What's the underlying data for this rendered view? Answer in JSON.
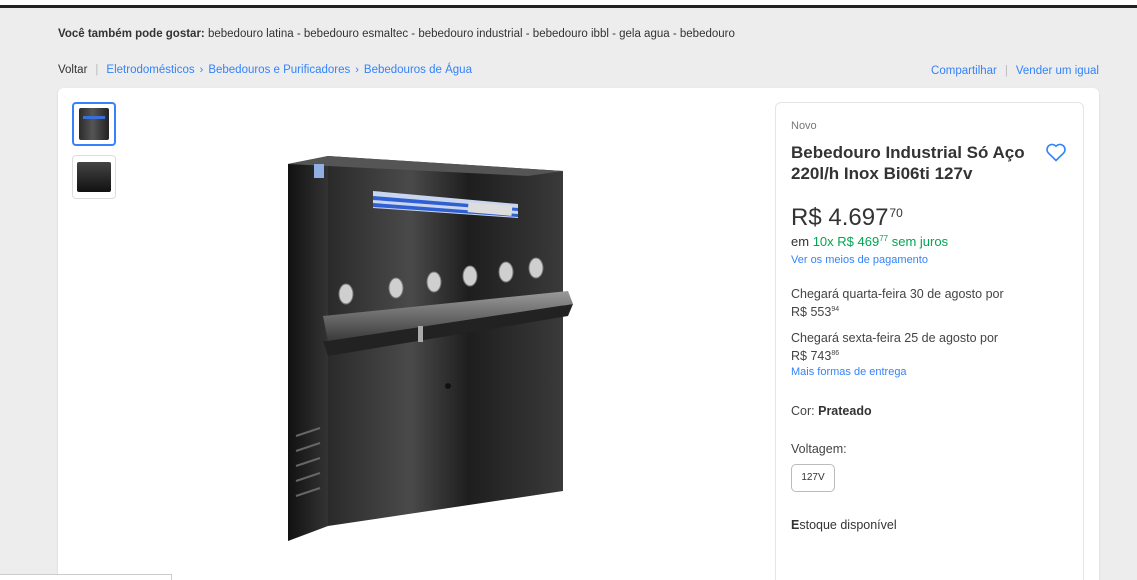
{
  "also_like": {
    "label": "Você também pode gostar:",
    "items": [
      "bebedouro latina",
      "bebedouro esmaltec",
      "bebedouro industrial",
      "bebedouro ibbl",
      "gela agua",
      "bebedouro"
    ],
    "separator": " - "
  },
  "breadcrumb": {
    "back": "Voltar",
    "items": [
      "Eletrodomésticos",
      "Bebedouros e Purificadores",
      "Bebedouros de Água"
    ]
  },
  "actions": {
    "share": "Compartilhar",
    "sell": "Vender um igual"
  },
  "product": {
    "condition": "Novo",
    "title": "Bebedouro Industrial Só Aço 220l/h Inox Bi06ti 127v",
    "price_currency": "R$",
    "price_integer": "4.697",
    "price_cents": "70",
    "installments_prefix": "em",
    "installments_count": "10x",
    "installment_value": "R$ 469",
    "installment_cents": "77",
    "installments_suffix": "sem juros",
    "payment_link": "Ver os meios de pagamento",
    "shipping_1_text": "Chegará quarta-feira 30 de agosto por",
    "shipping_1_price": "R$ 553",
    "shipping_1_cents": "94",
    "shipping_2_text": "Chegará sexta-feira 25 de agosto por",
    "shipping_2_price": "R$ 743",
    "shipping_2_cents": "86",
    "more_shipping": "Mais formas de entrega",
    "color_label": "Cor:",
    "color_value": "Prateado",
    "voltage_label": "Voltagem:",
    "voltage_option": "127V",
    "stock_first": "E",
    "stock_rest": "stoque disponível"
  },
  "colors": {
    "link": "#3483fa",
    "green": "#00a650",
    "background": "#ededed"
  }
}
